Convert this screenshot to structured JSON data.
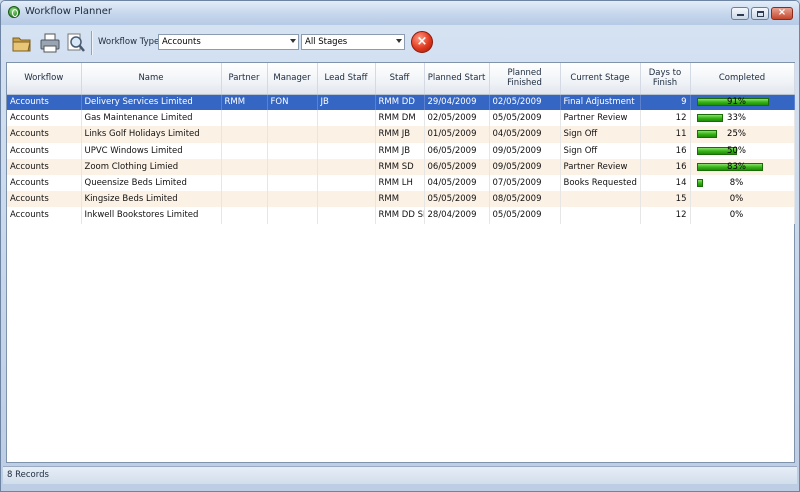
{
  "window": {
    "title": "Workflow Planner"
  },
  "toolbar": {
    "icons": [
      "folder-icon",
      "print-icon",
      "preview-icon"
    ],
    "workflow_type_label": "Workflow Type",
    "workflow_type_value": "Accounts",
    "stage_value": "All Stages",
    "cancel_icon": "cancel-icon"
  },
  "table": {
    "columns": [
      "Workflow",
      "Name",
      "Partner",
      "Manager",
      "Lead Staff",
      "Staff",
      "Planned Start",
      "Planned Finished",
      "Current Stage",
      "Days to Finish",
      "Completed"
    ],
    "rows": [
      {
        "workflow": "Accounts",
        "name": "Delivery Services Limited",
        "partner": "RMM",
        "manager": "FON",
        "lead_staff": "JB",
        "staff": "RMM  DD",
        "planned_start": "29/04/2009",
        "planned_finished": "02/05/2009",
        "current_stage": "Final Adjustment",
        "days_to_finish": "9",
        "completed_label": "91%",
        "completed": 0.91,
        "selected": true
      },
      {
        "workflow": "Accounts",
        "name": "Gas Maintenance Limited",
        "partner": "",
        "manager": "",
        "lead_staff": "",
        "staff": "RMM DM",
        "planned_start": "02/05/2009",
        "planned_finished": "05/05/2009",
        "current_stage": "Partner Review",
        "days_to_finish": "12",
        "completed_label": "33%",
        "completed": 0.33,
        "selected": false
      },
      {
        "workflow": "Accounts",
        "name": "Links Golf Holidays Limited",
        "partner": "",
        "manager": "",
        "lead_staff": "",
        "staff": "RMM JB",
        "planned_start": "01/05/2009",
        "planned_finished": "04/05/2009",
        "current_stage": "Sign Off",
        "days_to_finish": "11",
        "completed_label": "25%",
        "completed": 0.25,
        "selected": false
      },
      {
        "workflow": "Accounts",
        "name": "UPVC Windows Limited",
        "partner": "",
        "manager": "",
        "lead_staff": "",
        "staff": "RMM JB",
        "planned_start": "06/05/2009",
        "planned_finished": "09/05/2009",
        "current_stage": "Sign Off",
        "days_to_finish": "16",
        "completed_label": "50%",
        "completed": 0.5,
        "selected": false
      },
      {
        "workflow": "Accounts",
        "name": "Zoom Clothing Limied",
        "partner": "",
        "manager": "",
        "lead_staff": "",
        "staff": "RMM SD",
        "planned_start": "06/05/2009",
        "planned_finished": "09/05/2009",
        "current_stage": "Partner Review",
        "days_to_finish": "16",
        "completed_label": "83%",
        "completed": 0.83,
        "selected": false
      },
      {
        "workflow": "Accounts",
        "name": "Queensize Beds Limited",
        "partner": "",
        "manager": "",
        "lead_staff": "",
        "staff": "RMM LH",
        "planned_start": "04/05/2009",
        "planned_finished": "07/05/2009",
        "current_stage": "Books Requested",
        "days_to_finish": "14",
        "completed_label": "8%",
        "completed": 0.08,
        "selected": false
      },
      {
        "workflow": "Accounts",
        "name": "Kingsize Beds Limited",
        "partner": "",
        "manager": "",
        "lead_staff": "",
        "staff": "RMM",
        "planned_start": "05/05/2009",
        "planned_finished": "08/05/2009",
        "current_stage": "",
        "days_to_finish": "15",
        "completed_label": "0%",
        "completed": 0,
        "selected": false
      },
      {
        "workflow": "Accounts",
        "name": "Inkwell Bookstores Limited",
        "partner": "",
        "manager": "",
        "lead_staff": "",
        "staff": "RMM DD SD",
        "planned_start": "28/04/2009",
        "planned_finished": "05/05/2009",
        "current_stage": "",
        "days_to_finish": "12",
        "completed_label": "0%",
        "completed": 0,
        "selected": false
      }
    ]
  },
  "status": {
    "records": "8 Records"
  },
  "colors": {
    "selection": "#3666c4",
    "alt_row": "#fbf1e5",
    "progress": "#37b617"
  }
}
